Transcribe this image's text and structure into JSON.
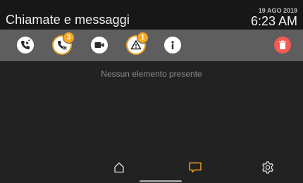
{
  "header": {
    "title": "Chiamate e messaggi",
    "date": "19 AGO 2019",
    "time": "6:23 AM"
  },
  "toolbar": {
    "buttons": [
      {
        "icon": "call-log-icon",
        "badge": ""
      },
      {
        "icon": "missed-call-icon",
        "badge": "3"
      },
      {
        "icon": "video-icon",
        "badge": ""
      },
      {
        "icon": "alarm-icon",
        "badge": "1"
      },
      {
        "icon": "info-icon",
        "badge": ""
      },
      {
        "icon": "trash-icon",
        "badge": ""
      }
    ]
  },
  "main": {
    "empty_message": "Nessun elemento presente"
  },
  "nav": {
    "items": [
      {
        "icon": "home-icon",
        "selected": false
      },
      {
        "icon": "message-icon",
        "selected": true
      },
      {
        "icon": "settings-icon",
        "selected": false
      }
    ]
  },
  "colors": {
    "accent": "#f5a623",
    "delete": "#f25a52",
    "toolbar_bg": "#5e5e5e",
    "header_bg": "#171717",
    "body_bg": "#222222"
  }
}
